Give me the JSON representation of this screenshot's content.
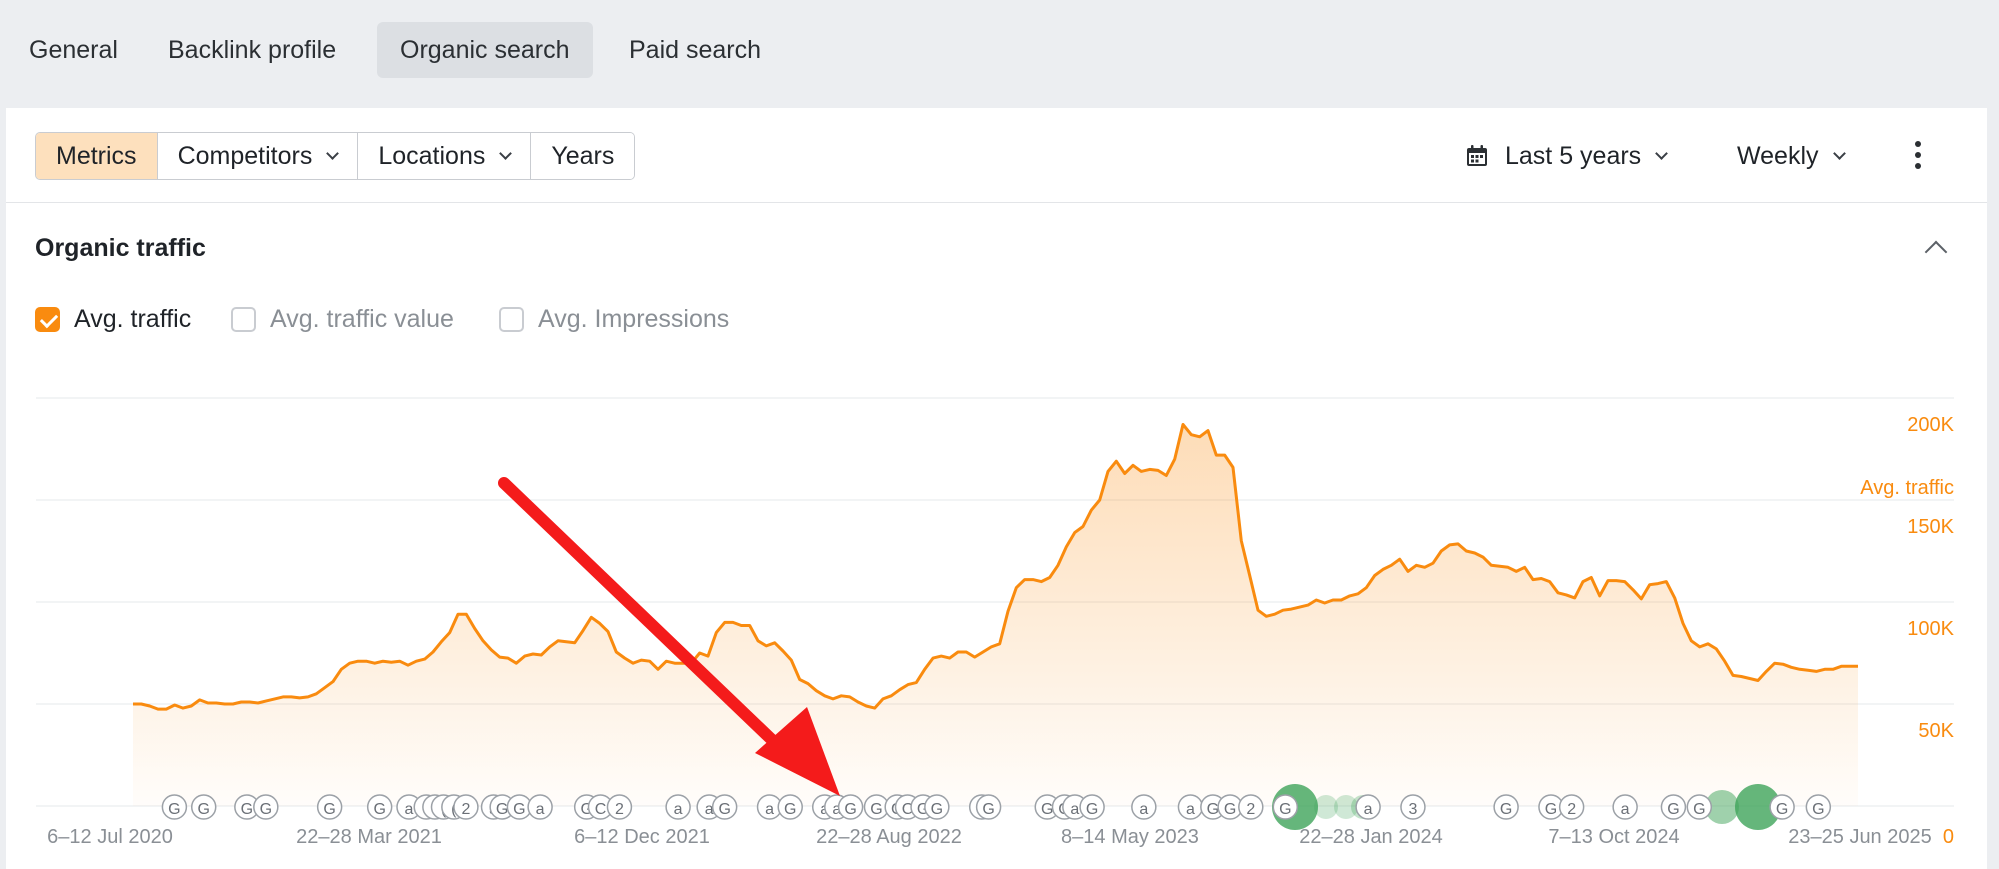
{
  "tabs": [
    {
      "label": "General",
      "active": false
    },
    {
      "label": "Backlink profile",
      "active": false
    },
    {
      "label": "Organic search",
      "active": true
    },
    {
      "label": "Paid search",
      "active": false
    }
  ],
  "toolbar": {
    "metrics": "Metrics",
    "competitors": "Competitors",
    "locations": "Locations",
    "years": "Years",
    "period": "Last 5 years",
    "granularity": "Weekly",
    "icons": {
      "period": "calendar-icon",
      "more": "more-vertical-icon"
    }
  },
  "section": {
    "title": "Organic traffic",
    "checkboxes": [
      {
        "label": "Avg. traffic",
        "checked": true
      },
      {
        "label": "Avg. traffic value",
        "checked": false
      },
      {
        "label": "Avg. Impressions",
        "checked": false
      }
    ]
  },
  "colors": {
    "accent": "#f98b0f",
    "google_update": "#3fa45a"
  },
  "chart_data": {
    "type": "area",
    "series": [
      {
        "name": "Avg. traffic",
        "values": [
          50000,
          50000,
          49000,
          47500,
          47500,
          49500,
          48000,
          49000,
          52000,
          50500,
          50500,
          50000,
          50000,
          51000,
          51000,
          50500,
          51500,
          52500,
          53500,
          53500,
          53000,
          53500,
          55000,
          58000,
          61000,
          67000,
          70000,
          71000,
          71000,
          70000,
          71000,
          70500,
          71000,
          69000,
          71000,
          72000,
          75500,
          80500,
          85000,
          94000,
          94000,
          87000,
          81000,
          76500,
          73000,
          72500,
          70000,
          73500,
          74500,
          74000,
          78000,
          81000,
          80500,
          80000,
          86000,
          92500,
          89500,
          85500,
          75500,
          72500,
          70000,
          71500,
          71000,
          67000,
          71000,
          70000,
          70000,
          70000,
          75000,
          73500,
          85000,
          90000,
          90000,
          88500,
          88500,
          81000,
          78500,
          80000,
          76000,
          71500,
          62000,
          60000,
          56500,
          54000,
          52500,
          54000,
          53500,
          51000,
          49000,
          48000,
          52500,
          54000,
          57000,
          59500,
          60500,
          67000,
          72500,
          73500,
          72500,
          75500,
          75500,
          73000,
          75500,
          78000,
          79500,
          95500,
          107000,
          111000,
          111000,
          110000,
          112000,
          118000,
          127000,
          134000,
          137000,
          145000,
          150000,
          164000,
          169000,
          163000,
          167000,
          164000,
          165000,
          164500,
          162000,
          170000,
          187000,
          182000,
          181000,
          184000,
          172000,
          172000,
          166000,
          130000,
          113000,
          96000,
          93000,
          94000,
          96000,
          96500,
          97500,
          98500,
          101000,
          99500,
          101000,
          101000,
          103000,
          104000,
          107000,
          113000,
          116000,
          118000,
          121000,
          115000,
          118000,
          117000,
          119000,
          125000,
          128000,
          128500,
          125000,
          124000,
          122000,
          118000,
          117500,
          117000,
          115000,
          117000,
          111000,
          111500,
          110000,
          104500,
          103500,
          102000,
          110000,
          112000,
          103000,
          110500,
          110500,
          110000,
          106000,
          101500,
          108500,
          109000,
          110000,
          102000,
          89500,
          81000,
          78000,
          79500,
          77000,
          71000,
          64000,
          63500,
          62500,
          61500,
          66000,
          70000,
          69500,
          68000,
          67000,
          66500,
          66000,
          67000,
          67000,
          68500,
          68500,
          68500
        ]
      }
    ],
    "x_tick_labels": [
      "6–12 Jul 2020",
      "22–28 Mar 2021",
      "6–12 Dec 2021",
      "22–28 Aug 2022",
      "8–14 May 2023",
      "22–28 Jan 2024",
      "7–13 Oct 2024",
      "23–25 Jun 2025"
    ],
    "y_tick_labels": [
      "0",
      "50K",
      "100K",
      "150K",
      "200K"
    ],
    "ylabel": "Avg. traffic",
    "ylim": [
      0,
      200000
    ],
    "grid": true,
    "annotation": "red arrow pointing to the dip at 22–28 Aug 2022",
    "update_markers": [
      {
        "t": 0.024,
        "label": "G"
      },
      {
        "t": 0.041,
        "label": "G"
      },
      {
        "t": 0.066,
        "label": "G"
      },
      {
        "t": 0.077,
        "label": "G"
      },
      {
        "t": 0.114,
        "label": "G"
      },
      {
        "t": 0.143,
        "label": "G"
      },
      {
        "t": 0.16,
        "label": "a"
      },
      {
        "t": 0.17,
        "label": "("
      },
      {
        "t": 0.175,
        "label": "("
      },
      {
        "t": 0.18,
        "label": "("
      },
      {
        "t": 0.186,
        "label": "("
      },
      {
        "t": 0.193,
        "label": "2"
      },
      {
        "t": 0.209,
        "label": "a"
      },
      {
        "t": 0.214,
        "label": "G"
      },
      {
        "t": 0.224,
        "label": "G"
      },
      {
        "t": 0.236,
        "label": "a"
      },
      {
        "t": 0.263,
        "label": "G"
      },
      {
        "t": 0.271,
        "label": "C"
      },
      {
        "t": 0.282,
        "label": "2"
      },
      {
        "t": 0.316,
        "label": "a"
      },
      {
        "t": 0.334,
        "label": "a"
      },
      {
        "t": 0.343,
        "label": "G"
      },
      {
        "t": 0.369,
        "label": "a"
      },
      {
        "t": 0.381,
        "label": "G"
      },
      {
        "t": 0.401,
        "label": "a"
      },
      {
        "t": 0.408,
        "label": "a"
      },
      {
        "t": 0.416,
        "label": "G"
      },
      {
        "t": 0.431,
        "label": "G"
      },
      {
        "t": 0.443,
        "label": "G"
      },
      {
        "t": 0.449,
        "label": "C"
      },
      {
        "t": 0.458,
        "label": "G"
      },
      {
        "t": 0.466,
        "label": "G"
      },
      {
        "t": 0.492,
        "label": "G"
      },
      {
        "t": 0.496,
        "label": "G"
      },
      {
        "t": 0.53,
        "label": "G"
      },
      {
        "t": 0.54,
        "label": "G"
      },
      {
        "t": 0.546,
        "label": "a"
      },
      {
        "t": 0.556,
        "label": "G"
      },
      {
        "t": 0.586,
        "label": "a"
      },
      {
        "t": 0.613,
        "label": "a"
      },
      {
        "t": 0.626,
        "label": "G"
      },
      {
        "t": 0.636,
        "label": "G"
      },
      {
        "t": 0.648,
        "label": "2"
      },
      {
        "t": 0.668,
        "label": "G"
      },
      {
        "t": 0.716,
        "label": "a"
      },
      {
        "t": 0.742,
        "label": "3"
      },
      {
        "t": 0.796,
        "label": "G"
      },
      {
        "t": 0.822,
        "label": "G"
      },
      {
        "t": 0.834,
        "label": "2"
      },
      {
        "t": 0.865,
        "label": "a"
      },
      {
        "t": 0.893,
        "label": "G"
      },
      {
        "t": 0.908,
        "label": "G"
      },
      {
        "t": 0.956,
        "label": "G"
      },
      {
        "t": 0.977,
        "label": "G"
      }
    ]
  }
}
